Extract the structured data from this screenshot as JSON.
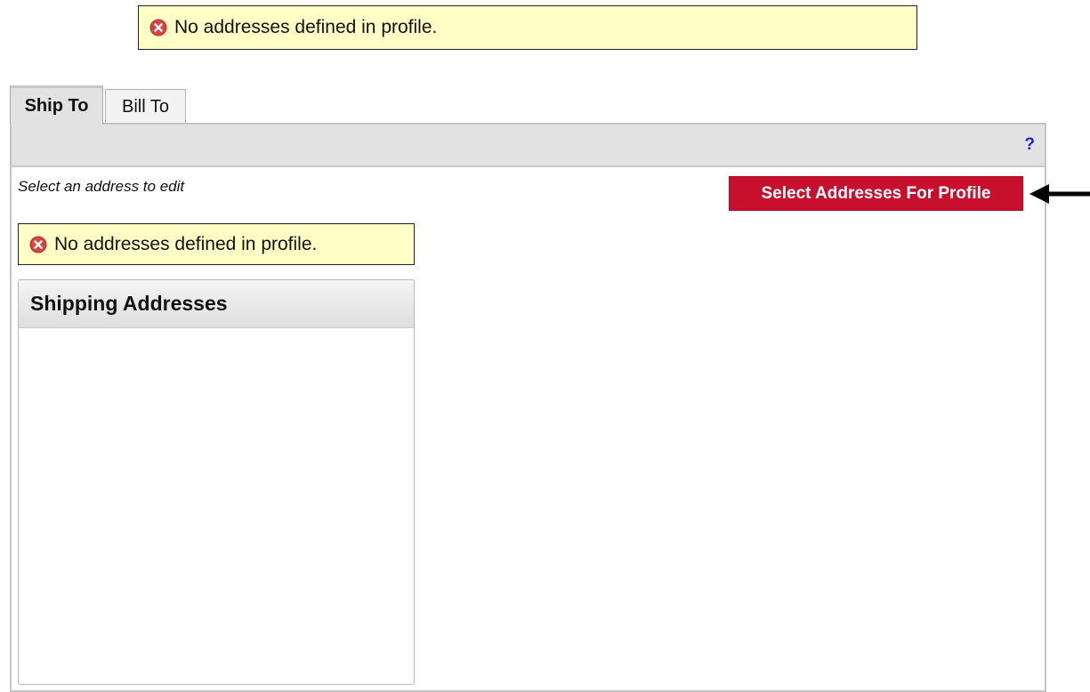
{
  "messages": {
    "top_error": "No addresses defined in profile.",
    "inner_error": "No addresses defined in profile.",
    "error_icon": "error-x-icon",
    "error_icon_color": "#d64545"
  },
  "tabs": [
    {
      "label": "Ship To",
      "active": true
    },
    {
      "label": "Bill To",
      "active": false
    }
  ],
  "panel": {
    "help_label": "?",
    "instructions": "Select an address to edit",
    "select_button_label": "Select Addresses For Profile",
    "button_color": "#c8102e"
  },
  "shipping": {
    "title": "Shipping Addresses",
    "items": []
  },
  "annotation": {
    "icon": "left-arrow-icon",
    "color": "#000000"
  }
}
